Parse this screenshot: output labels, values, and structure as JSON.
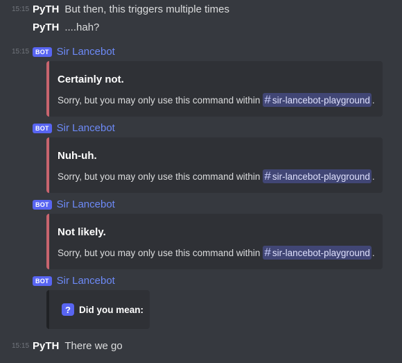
{
  "messages": [
    {
      "timestamp": "15:15",
      "author": "PyTH",
      "text": "But then, this triggers multiple times"
    },
    {
      "author": "PyTH",
      "text": "....hah?"
    }
  ],
  "bot": {
    "timestamp": "15:15",
    "badge": "BOT",
    "name": "Sir Lancebot",
    "embeds": [
      {
        "title": "Certainly not.",
        "desc": "Sorry, but you may only use this command within",
        "channel": "sir-lancebot-playground",
        "period": "."
      },
      {
        "title": "Nuh-uh.",
        "desc": "Sorry, but you may only use this command within",
        "channel": "sir-lancebot-playground",
        "period": "."
      },
      {
        "title": "Not likely.",
        "desc": "Sorry, but you may only use this command within",
        "channel": "sir-lancebot-playground",
        "period": "."
      }
    ],
    "did_you_mean": "Did you mean:",
    "question_mark": "?"
  },
  "last_message": {
    "timestamp": "15:15",
    "author": "PyTH",
    "text": "There we go"
  },
  "icons": {
    "hash": "#"
  },
  "colors": {
    "accent": "#5865f2",
    "embed_border": "#c8646e",
    "background": "#36393f",
    "embed_bg": "#2f3136"
  }
}
